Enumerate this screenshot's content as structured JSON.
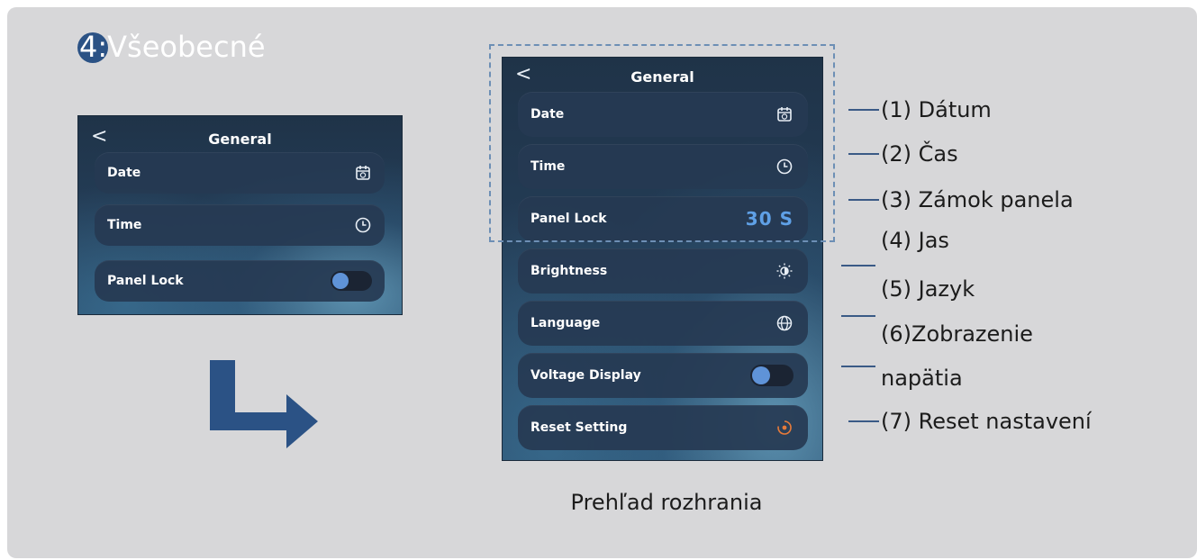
{
  "section": {
    "number": "4:",
    "title": "Všeobecné"
  },
  "screen_small": {
    "back": "<",
    "title": "General",
    "rows": [
      {
        "label": "Date",
        "icon": "calendar-icon"
      },
      {
        "label": "Time",
        "icon": "clock-icon"
      },
      {
        "label": "Panel Lock",
        "control": "toggle",
        "toggle_state": "off"
      }
    ]
  },
  "screen_large": {
    "back": "<",
    "title": "General",
    "rows": [
      {
        "label": "Date",
        "icon": "calendar-icon"
      },
      {
        "label": "Time",
        "icon": "clock-icon"
      },
      {
        "label": "Panel Lock",
        "value": "30 S"
      },
      {
        "label": "Brightness",
        "icon": "brightness-icon"
      },
      {
        "label": "Language",
        "icon": "globe-icon"
      },
      {
        "label": "Voltage Display",
        "control": "toggle",
        "toggle_state": "off"
      },
      {
        "label": "Reset Setting",
        "icon": "reset-icon"
      }
    ]
  },
  "callouts": [
    "(1) Dátum",
    "(2) Čas",
    "(3) Zámok panela",
    "(4) Jas",
    "(5) Jazyk",
    "(6)Zobrazenie",
    "napätia",
    "(7) Reset nastavení"
  ],
  "caption": "Prehľad rozhrania",
  "colors": {
    "accent_blue": "#2b5285",
    "panel_bg": "#d7d7d9",
    "screen_dark": "#1f3348",
    "value_blue": "#5fa0e6",
    "reset_orange": "#e67a3a",
    "toggle_knob": "#5f93d8"
  }
}
